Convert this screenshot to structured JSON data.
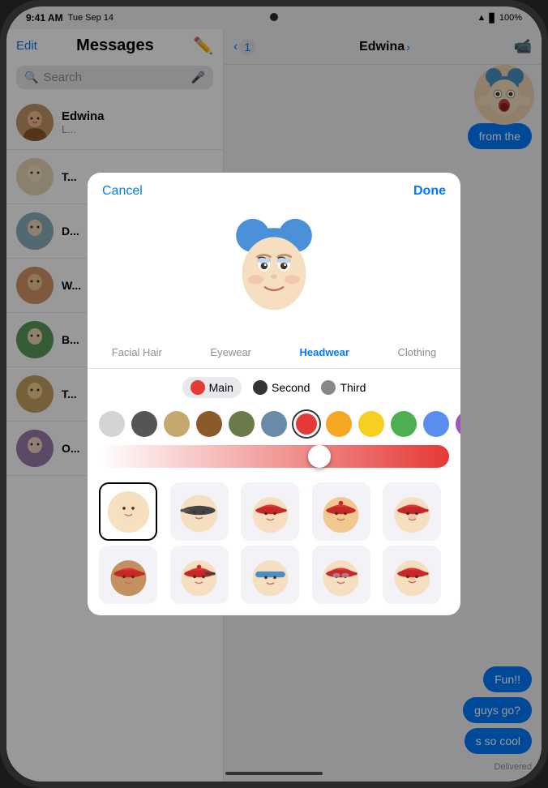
{
  "device": {
    "status_bar": {
      "time": "9:41 AM",
      "date": "Tue Sep 14",
      "wifi": "WiFi",
      "battery": "100%"
    }
  },
  "sidebar": {
    "edit_label": "Edit",
    "title": "Messages",
    "search_placeholder": "Search",
    "contacts": [
      {
        "name": "Edwina",
        "preview": "L...",
        "avatar_color": "#8b6f5e"
      },
      {
        "name": "",
        "preview": "T...",
        "avatar_color": "#e8c4a0"
      },
      {
        "name": "",
        "preview": "D...",
        "avatar_color": "#5a7a8a"
      },
      {
        "name": "",
        "preview": "W...",
        "avatar_color": "#c47a4a"
      },
      {
        "name": "",
        "preview": "B...",
        "avatar_color": "#3a6a3a"
      },
      {
        "name": "",
        "preview": "T...",
        "avatar_color": "#c4a060",
        "unread": true
      },
      {
        "name": "",
        "preview": "O...",
        "avatar_color": "#7a5a8a"
      }
    ]
  },
  "chat": {
    "back_label": "1",
    "contact_name": "Edwina",
    "chevron": ">",
    "messages": [
      {
        "text": "from the",
        "type": "sent"
      },
      {
        "text": "Fun!!",
        "type": "sent"
      },
      {
        "text": "guys go?",
        "type": "sent"
      },
      {
        "text": "s so cool",
        "type": "sent"
      }
    ],
    "delivered_label": "Delivered"
  },
  "modal": {
    "cancel_label": "Cancel",
    "done_label": "Done",
    "categories": [
      {
        "label": "Facial Hair",
        "active": false
      },
      {
        "label": "Eyewear",
        "active": false
      },
      {
        "label": "Headwear",
        "active": true
      },
      {
        "label": "Clothing",
        "active": false
      }
    ],
    "color_options": [
      {
        "label": "Main",
        "color": "#e53935",
        "selected": true
      },
      {
        "label": "Second",
        "color": "#333333",
        "selected": false
      },
      {
        "label": "Third",
        "color": "#888888",
        "selected": false
      }
    ],
    "swatches": [
      {
        "color": "#d4d4d4",
        "selected": false
      },
      {
        "color": "#555555",
        "selected": false
      },
      {
        "color": "#c4a870",
        "selected": false
      },
      {
        "color": "#8b5a2b",
        "selected": false
      },
      {
        "color": "#6b7a4a",
        "selected": false
      },
      {
        "color": "#6a8aaa",
        "selected": false
      },
      {
        "color": "#e53935",
        "selected": true
      },
      {
        "color": "#f5a623",
        "selected": false
      },
      {
        "color": "#f5d020",
        "selected": false
      },
      {
        "color": "#4caf50",
        "selected": false
      },
      {
        "color": "#5b8def",
        "selected": false
      },
      {
        "color": "#9b59b6",
        "selected": false
      },
      {
        "color": "#ff69b4",
        "selected": false
      }
    ],
    "slider_value": 63,
    "headwear_items": [
      {
        "id": 1,
        "selected": true,
        "label": "none"
      },
      {
        "id": 2,
        "selected": false,
        "label": "cap-back"
      },
      {
        "id": 3,
        "selected": false,
        "label": "cap-front"
      },
      {
        "id": 4,
        "selected": false,
        "label": "cap-sideways"
      },
      {
        "id": 5,
        "selected": false,
        "label": "cap-red-1"
      },
      {
        "id": 6,
        "selected": false,
        "label": "cap-red-2"
      },
      {
        "id": 7,
        "selected": false,
        "label": "cap-red-3"
      },
      {
        "id": 8,
        "selected": false,
        "label": "headband"
      },
      {
        "id": 9,
        "selected": false,
        "label": "cap-red-4"
      },
      {
        "id": 10,
        "selected": false,
        "label": "cap-red-5"
      }
    ]
  }
}
